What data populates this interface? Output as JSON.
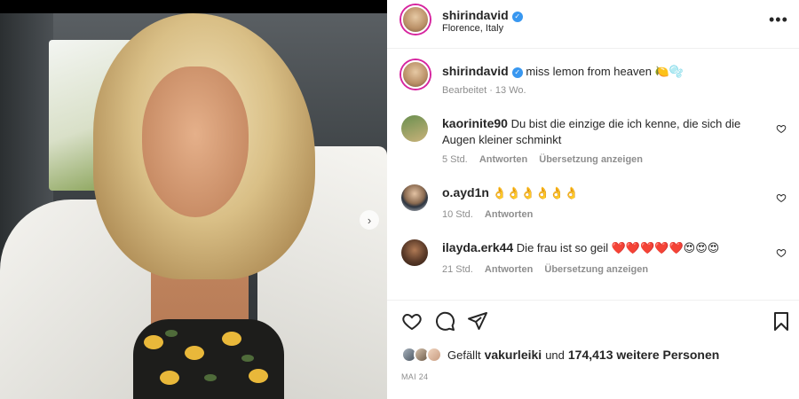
{
  "post": {
    "username": "shirindavid",
    "location": "Florence, Italy",
    "more_label": "•••",
    "caption": {
      "username": "shirindavid",
      "text": "miss lemon from heaven 🍋🫧",
      "meta": "Bearbeitet · 13 Wo."
    }
  },
  "comments": [
    {
      "username": "kaorinite90",
      "text": "Du bist die einzige die ich kenne, die sich die Augen kleiner schminkt",
      "time": "5 Std.",
      "reply": "Antworten",
      "translate": "Übersetzung anzeigen"
    },
    {
      "username": "o.ayd1n",
      "text": "👌👌👌👌👌👌",
      "time": "10 Std.",
      "reply": "Antworten",
      "translate": ""
    },
    {
      "username": "ilayda.erk44",
      "text": "Die frau ist so geil ❤️❤️❤️❤️❤️😍😍😍",
      "time": "21 Std.",
      "reply": "Antworten",
      "translate": "Übersetzung anzeigen"
    }
  ],
  "likes": {
    "prefix": "Gefällt",
    "user": "vakurleiki",
    "connector": "und",
    "count_text": "174,413 weitere Personen"
  },
  "date": "MAI 24",
  "icons": {
    "like": "heart-icon",
    "comment": "comment-icon",
    "share": "share-icon",
    "save": "bookmark-icon",
    "next": "chevron-right-icon",
    "verified": "verified-badge-icon"
  },
  "carousel": {
    "count": 9,
    "active_index": 0
  },
  "colors": {
    "verified_blue": "#3897f0",
    "text": "#262626",
    "secondary": "#8e8e8e",
    "story_ring": "#d6249f"
  }
}
